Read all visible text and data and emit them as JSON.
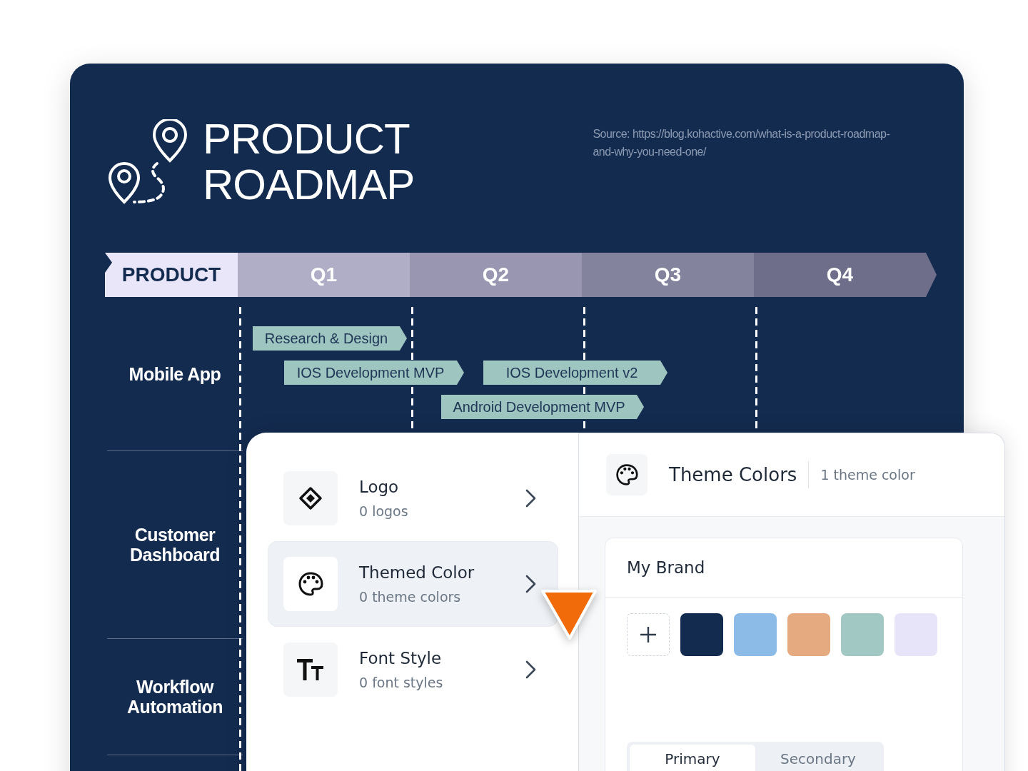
{
  "roadmap": {
    "title_lines": [
      "PRODUCT",
      "ROADMAP"
    ],
    "source": "Source: https://blog.kohactive.com/what-is-a-product-roadmap-and-why-you-need-one/",
    "header": {
      "label": "PRODUCT",
      "quarters": [
        "Q1",
        "Q2",
        "Q3",
        "Q4"
      ]
    },
    "rows": [
      {
        "label": "Mobile App",
        "tasks": [
          {
            "label": "Research & Design"
          },
          {
            "label": "IOS Development MVP"
          },
          {
            "label": "IOS Development v2"
          },
          {
            "label": "Android Development MVP"
          }
        ]
      },
      {
        "label": "Customer Dashboard",
        "tasks": []
      },
      {
        "label": "Workflow Automation",
        "tasks": []
      }
    ]
  },
  "panel": {
    "items": [
      {
        "kind": "logo",
        "title": "Logo",
        "subtitle": "0 logos",
        "selected": false
      },
      {
        "kind": "palette",
        "title": "Themed Color",
        "subtitle": "0 theme colors",
        "selected": true
      },
      {
        "kind": "font",
        "title": "Font Style",
        "subtitle": "0 font styles",
        "selected": false
      }
    ],
    "detail": {
      "title": "Theme Colors",
      "count": "1 theme color",
      "brand": {
        "name": "My Brand",
        "swatches": [
          {
            "color": "#132b4f"
          },
          {
            "color": "#8bbbe6"
          },
          {
            "color": "#e6aa80"
          },
          {
            "color": "#a2c8c4"
          },
          {
            "color": "#e7e3f8"
          }
        ]
      },
      "tabs": [
        {
          "label": "Primary",
          "selected": true
        },
        {
          "label": "Secondary",
          "selected": false
        }
      ]
    }
  }
}
